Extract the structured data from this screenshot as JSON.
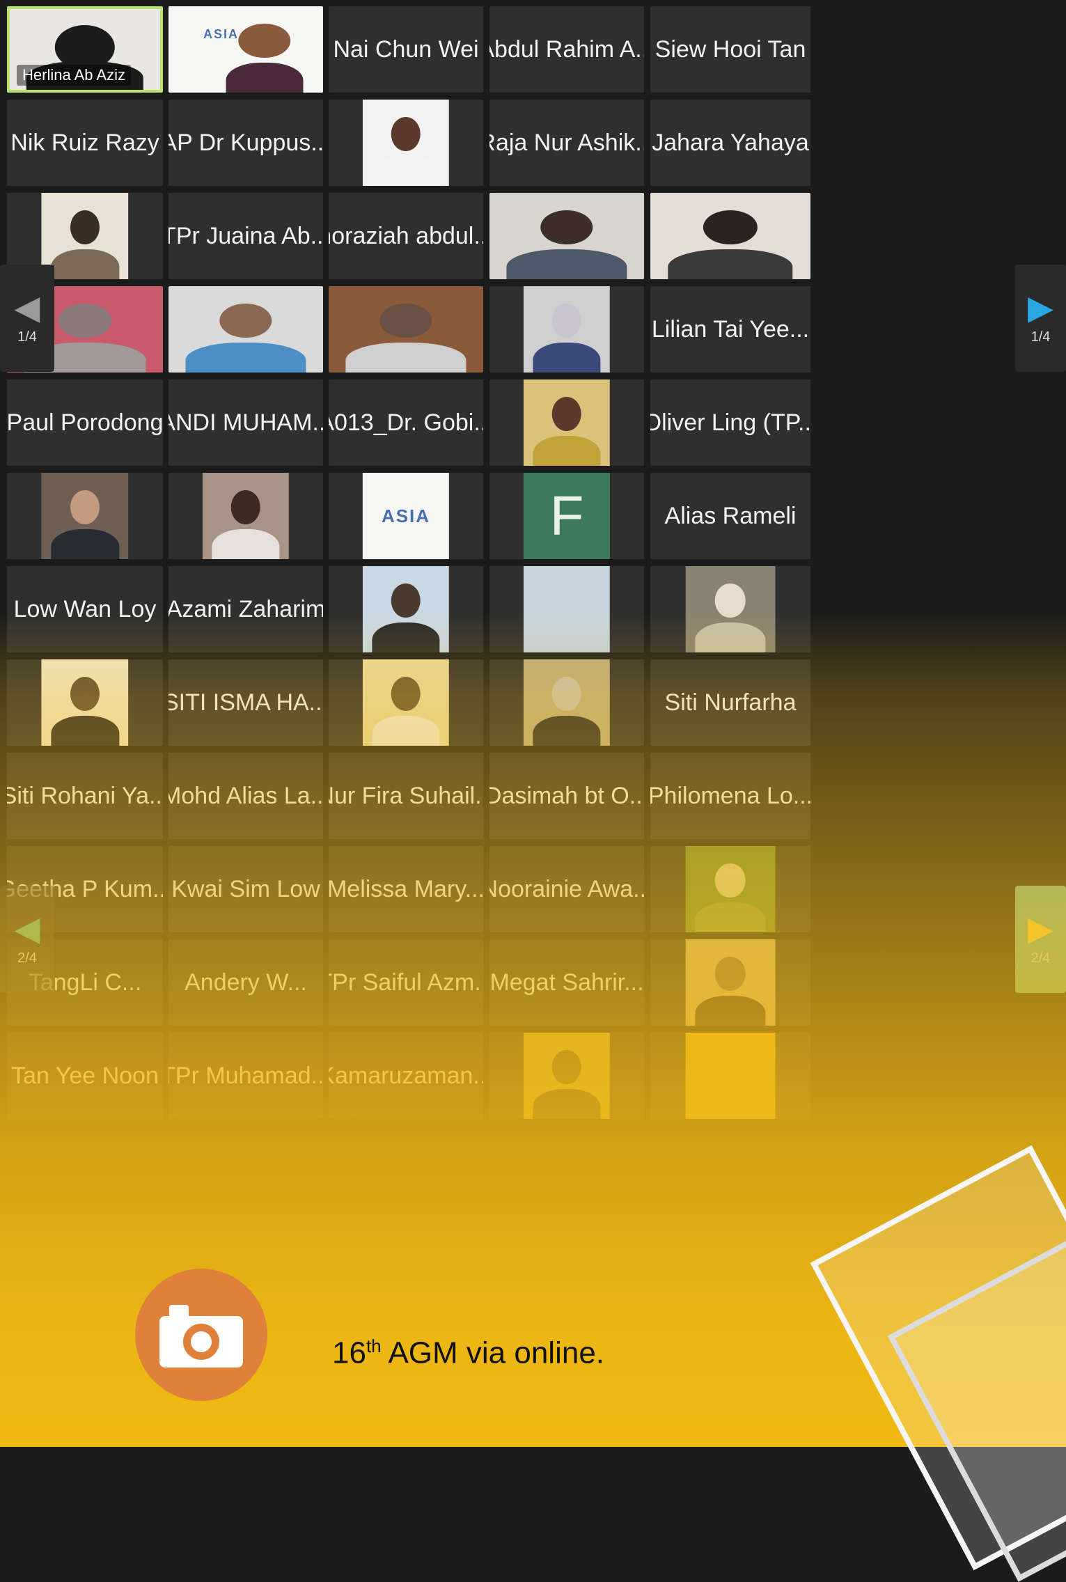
{
  "grid": {
    "rows": [
      [
        {
          "name": "Herlina Ab Aziz",
          "video": true,
          "active": true,
          "muted": true
        },
        {
          "logo": "ASIA",
          "video": true
        },
        {
          "name": "Nai Chun Wei"
        },
        {
          "name": "Abdul Rahim A..."
        },
        {
          "name": "Siew Hooi Tan"
        }
      ],
      [
        {
          "name": "Nik Ruiz Razy"
        },
        {
          "name": "AP Dr Kuppus..."
        },
        {
          "photo": "man-red-tie"
        },
        {
          "name": "Raja Nur Ashik..."
        },
        {
          "name": "Jahara Yahaya"
        }
      ],
      [
        {
          "photo": "woman-uniform"
        },
        {
          "name": "TPr Juaina Ab..."
        },
        {
          "name": "noraziah abdul..."
        },
        {
          "video": "man-glasses"
        },
        {
          "video": "woman-speaking"
        }
      ],
      [
        {
          "video": "woman-hijab-flowers"
        },
        {
          "video": "man-blue-shirt"
        },
        {
          "video": "man-library"
        },
        {
          "photo": "woman-hijab-car"
        },
        {
          "name": "Lilian Tai Yee..."
        }
      ],
      [
        {
          "name": "Paul Porodong"
        },
        {
          "name": "ANDI MUHAM..."
        },
        {
          "name": "A013_Dr. Gobi..."
        },
        {
          "photo": "man-batik"
        },
        {
          "name": "Oliver Ling (TP..."
        }
      ],
      [
        {
          "photo": "man-suit"
        },
        {
          "photo": "woman-smiling"
        },
        {
          "logo": "ASIA"
        },
        {
          "letter": "F"
        },
        {
          "name": "Alias Rameli"
        }
      ],
      [
        {
          "name": "Low Wan Loy"
        },
        {
          "name": "Azami Zaharim"
        },
        {
          "photo": "man-arms-crossed"
        },
        {
          "photo": "beach"
        },
        {
          "photo": "woman-hijab"
        }
      ],
      [
        {
          "photo": "man-young"
        },
        {
          "name": "SITI ISMA HA..."
        },
        {
          "photo": "child"
        },
        {
          "photo": "man-elder"
        },
        {
          "name": "Siti Nurfarha"
        }
      ],
      [
        {
          "name": "Siti Rohani Ya..."
        },
        {
          "name": "Mohd Alias La..."
        },
        {
          "name": "Nur Fira Suhail..."
        },
        {
          "name": "Dasimah bt O..."
        },
        {
          "name": "Philomena Lo..."
        }
      ],
      [
        {
          "name": "Geetha P Kum..."
        },
        {
          "name": "Kwai Sim Low"
        },
        {
          "name": "Melissa Mary..."
        },
        {
          "name": "Noorainie Awa..."
        },
        {
          "photo": "poster"
        }
      ],
      [
        {
          "name": "TangLi C..."
        },
        {
          "name": "Andery W..."
        },
        {
          "name": "TPr Saiful Azm..."
        },
        {
          "name": "Megat Sahrir..."
        },
        {
          "photo": "man-portrait"
        }
      ],
      [
        {
          "name": "Tan Yee Noon"
        },
        {
          "name": "TPr Muhamad..."
        },
        {
          "name": "Kamaruzaman..."
        },
        {
          "photo": "man-dark"
        },
        {
          "photo": "blank"
        }
      ]
    ]
  },
  "pager_top": {
    "left": "1/4",
    "right": "1/4"
  },
  "pager_bottom": {
    "left": "2/4",
    "right": "2/4"
  },
  "caption": {
    "prefix": "16",
    "sup": "th",
    "text": " AGM via online."
  },
  "icons": {
    "camera": "camera-icon"
  },
  "colors": {
    "overlay": "#f2b913",
    "camera_circle": "#e0813b",
    "active_border": "#b9e36a",
    "nav_blue": "#2aa6e0",
    "nav_teal": "#4fb8a0"
  }
}
